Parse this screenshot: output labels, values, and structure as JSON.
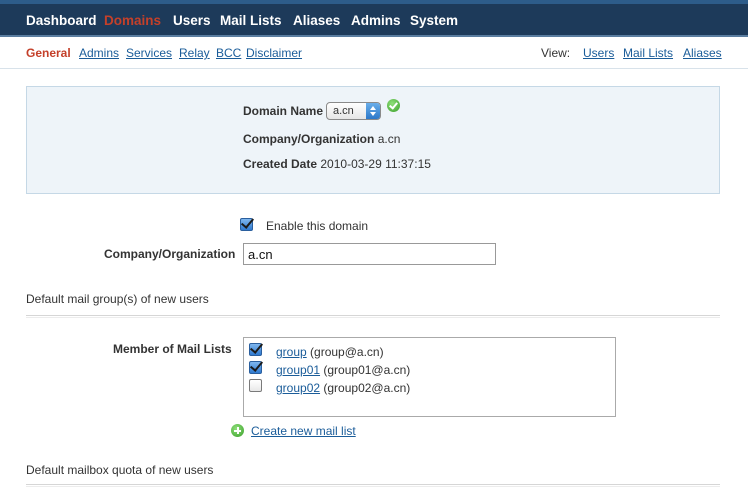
{
  "top_nav": {
    "items": [
      {
        "label": "Dashboard"
      },
      {
        "label": "Domains",
        "active": true
      },
      {
        "label": "Users"
      },
      {
        "label": "Mail Lists"
      },
      {
        "label": "Aliases"
      },
      {
        "label": "Admins"
      },
      {
        "label": "System"
      }
    ]
  },
  "sub_nav": {
    "tabs": [
      "General",
      "Admins",
      "Services",
      "Relay",
      "BCC",
      "Disclaimer"
    ],
    "active_tab": "General",
    "view_label": "View:",
    "view_links": [
      "Users",
      "Mail Lists",
      "Aliases"
    ]
  },
  "info": {
    "domain_name_label": "Domain Name",
    "domain_name_value": "a.cn",
    "company_label": "Company/Organization",
    "company_value": "a.cn",
    "created_label": "Created Date",
    "created_value": "2010-03-29 11:37:15"
  },
  "form": {
    "enable_label": "Enable this domain",
    "enable_checked": true,
    "company_label": "Company/Organization",
    "company_value": "a.cn"
  },
  "mail_group_section": {
    "title": "Default mail group(s) of new users",
    "member_label": "Member of Mail Lists",
    "lists": [
      {
        "name": "group",
        "address": "(group@a.cn)",
        "checked": true
      },
      {
        "name": "group01",
        "address": "(group01@a.cn)",
        "checked": true
      },
      {
        "name": "group02",
        "address": "(group02@a.cn)",
        "checked": false
      }
    ],
    "create_link": "Create new mail list"
  },
  "quota_section": {
    "title": "Default mailbox quota of new users"
  },
  "colors": {
    "nav_bg": "#1d3a5a",
    "active": "#c4402a",
    "link": "#1a5c99",
    "info_bg": "#eef4f9"
  }
}
